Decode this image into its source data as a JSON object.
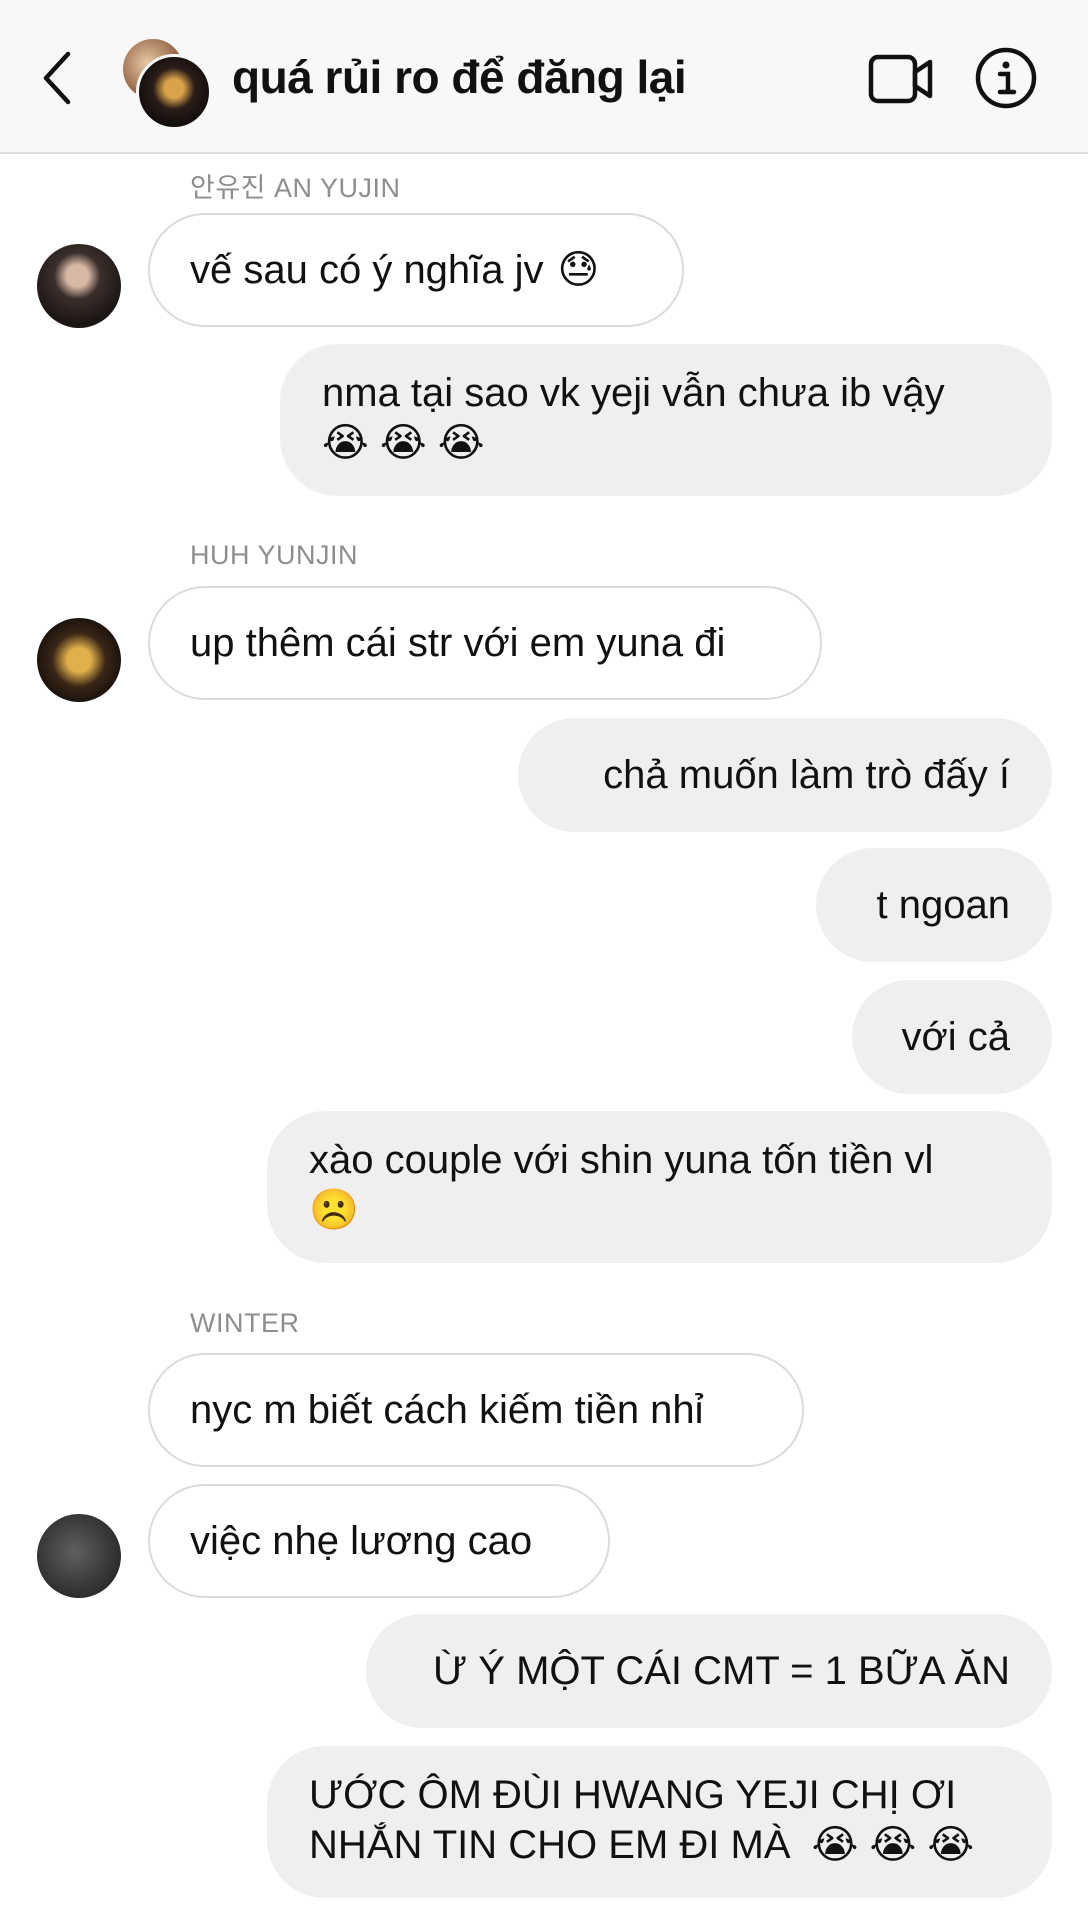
{
  "header": {
    "title": "quá rủi ro để đăng lại"
  },
  "messages": {
    "m1": {
      "sender": "안유진 AN YUJIN",
      "text": "vế sau có ý nghĩa jv",
      "emoji": "😓"
    },
    "m2": {
      "line1": "nma tại sao vk yeji vẫn chưa ib vậy",
      "line2": "😭 😭 😭"
    },
    "m3": {
      "sender": "HUH YUNJIN",
      "text": "up thêm cái str với em yuna đi"
    },
    "m4": {
      "text": "chả muốn làm trò đấy í"
    },
    "m5": {
      "text": "t ngoan"
    },
    "m6": {
      "text": "với cả"
    },
    "m7": {
      "line1": "xào couple với shin yuna tốn tiền vl",
      "line2": "☹️"
    },
    "m8": {
      "sender": "WINTER",
      "text": "nyc m biết cách kiếm tiền nhỉ"
    },
    "m9": {
      "text": "việc nhẹ lương cao"
    },
    "m10": {
      "text": "Ừ Ý MỘT CÁI CMT = 1 BỮA ĂN"
    },
    "m11": {
      "line1": "ƯỚC ÔM ĐÙI HWANG YEJI CHỊ ƠI",
      "line2": "NHẮN TIN CHO EM ĐI MÀ",
      "emoji": "😭 😭 😭"
    }
  }
}
